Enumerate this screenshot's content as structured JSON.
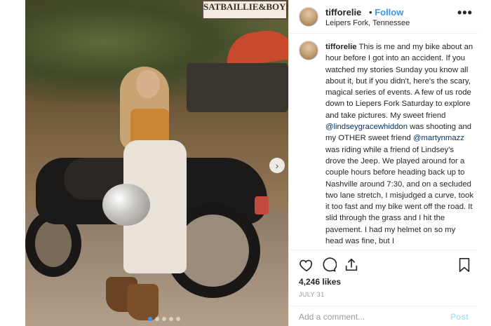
{
  "photo": {
    "sign_text": "SATBAILLIE&BOYS",
    "carousel_dots": 5,
    "active_dot": 0
  },
  "header": {
    "username": "tifforelie",
    "separator": "•",
    "follow_label": "Follow",
    "location": "Leipers Fork, Tennessee",
    "more_label": "•••"
  },
  "caption": {
    "username": "tifforelie",
    "text_1": " This is me and my bike about an hour before I got into an accident. If you watched my stories Sunday you know all about it, but if you didn't, here's the scary, magical series of events. A few of us rode down to Liepers Fork Saturday to explore and take pictures. My sweet friend ",
    "mention_1": "@lindseygracewhiddon",
    "text_2": " was shooting and my OTHER sweet friend ",
    "mention_2": "@martynmazz",
    "text_3": " was riding while a friend of Lindsey's drove the Jeep. We played around for a couple hours before heading back up to Nashville around 7:30, and on a secluded two lane stretch, I misjudged a curve, took it too fast and my bike went off the road. It slid through the grass and I hit the pavement. I had my helmet on so my head was fine, but I"
  },
  "actions": {
    "likes": "4,246 likes",
    "date": "JULY 31",
    "comment_placeholder": "Add a comment...",
    "post_label": "Post",
    "icons": [
      "heart-icon",
      "comment-icon",
      "share-icon",
      "bookmark-icon"
    ]
  },
  "colors": {
    "link": "#3897f0",
    "mention": "#003569",
    "border": "#efefef",
    "post_disabled": "#b2dffc"
  }
}
